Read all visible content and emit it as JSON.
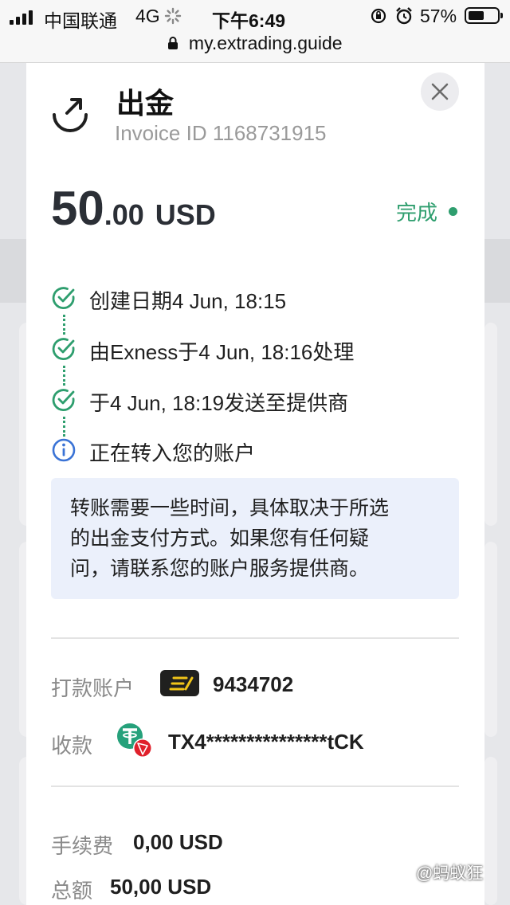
{
  "status_bar": {
    "carrier": "中国联通",
    "network": "4G",
    "time": "下午6:49",
    "battery": "57%",
    "battery_level": 0.57
  },
  "browser": {
    "url": "my.extrading.guide"
  },
  "modal": {
    "title": "出金",
    "invoice_label": "Invoice ID 1168731915",
    "amount_major": "50",
    "amount_minor": ".00",
    "amount_currency": "USD",
    "status_label": "完成",
    "status_color": "#2e9e6e",
    "steps": [
      {
        "text": "创建日期4 Jun, 18:15",
        "state": "done",
        "icon": "check-circle-icon"
      },
      {
        "text": "由Exness于4 Jun, 18:16处理",
        "state": "done",
        "icon": "check-circle-icon"
      },
      {
        "text": "于4 Jun, 18:19发送至提供商",
        "state": "done",
        "icon": "check-circle-icon"
      },
      {
        "text": "正在转入您的账户",
        "state": "pending",
        "icon": "info-circle-icon"
      }
    ],
    "notice_lines": [
      "转账需要一些时间，具体取决于所选",
      "的出金支付方式。如果您有任何疑",
      "问，请联系您的账户服务提供商。"
    ],
    "details": {
      "from_label": "打款账户",
      "from_value": "9434702",
      "from_icon": "exness-logo-icon",
      "to_label": "收款",
      "to_value": "TX4***************tCK",
      "to_icon": "tether-tron-icon",
      "fee_label": "手续费",
      "fee_value": "0,00 USD",
      "total_label": "总额",
      "total_value": "50,00 USD"
    }
  },
  "watermark": "@蚂蚁狂"
}
